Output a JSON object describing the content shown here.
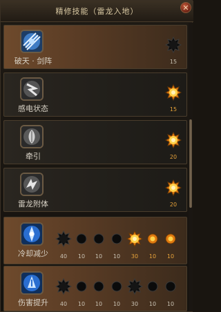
{
  "window": {
    "title": "精修技能（雷龙入地）"
  },
  "skills": [
    {
      "name": "破天 · 剑阵",
      "icon": "sword-formation-icon",
      "costs": [
        "15"
      ]
    },
    {
      "name": "感电状态",
      "icon": "electrified-state-icon",
      "costs": [
        "15"
      ]
    },
    {
      "name": "牵引",
      "icon": "traction-icon",
      "costs": [
        "20"
      ]
    },
    {
      "name": "雷龙附体",
      "icon": "thunder-dragon-possession-icon",
      "costs": [
        "20"
      ]
    },
    {
      "name": "冷却减少",
      "icon": "cooldown-reduction-icon",
      "costs": [
        "40",
        "10",
        "10",
        "10",
        "30",
        "10",
        "10"
      ]
    },
    {
      "name": "伤害提升",
      "icon": "damage-boost-icon",
      "costs": [
        "40",
        "10",
        "10",
        "10",
        "30",
        "10",
        "10"
      ]
    }
  ],
  "colors": {
    "active_node": "#f0a020",
    "inactive_node": "#0b0b0b",
    "row_highlight": "#5a3c25"
  }
}
